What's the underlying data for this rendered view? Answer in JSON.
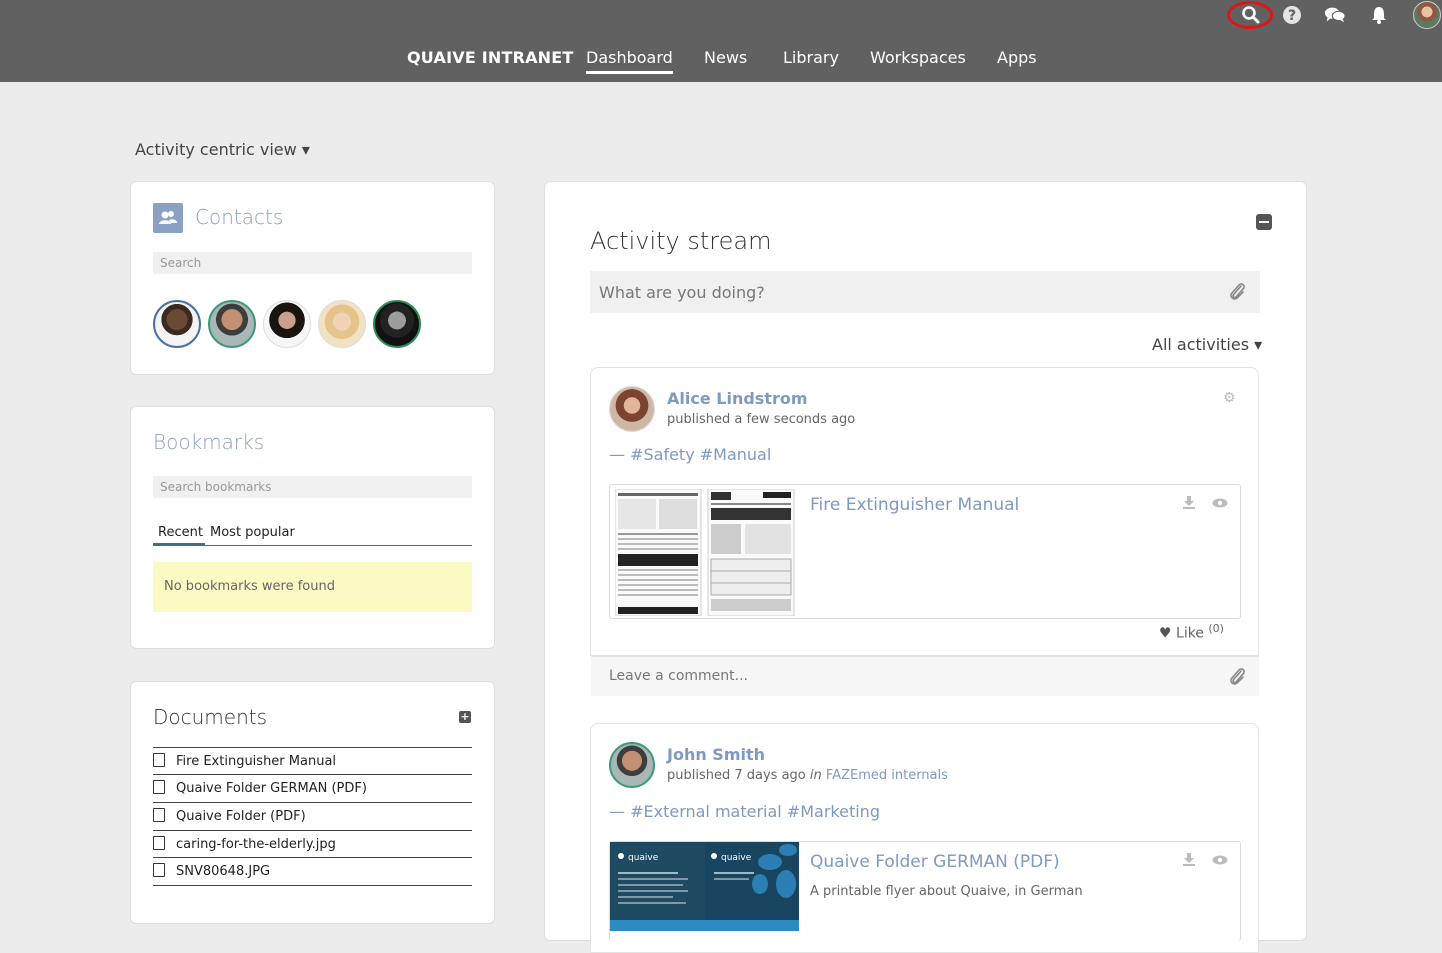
{
  "topbar": {
    "brand": "QUAIVE INTRANET",
    "nav": [
      "Dashboard",
      "News",
      "Library",
      "Workspaces",
      "Apps"
    ],
    "active_tab": "Dashboard",
    "icons": [
      "search-icon",
      "help-icon",
      "chat-icon",
      "bell-icon",
      "user-avatar"
    ],
    "colors": {
      "background": "#616161",
      "highlight_ring": "#e0151a"
    }
  },
  "view_toggle": "Activity centric view ▾",
  "contacts": {
    "title": "Contacts",
    "search_placeholder": "Search"
  },
  "bookmarks": {
    "title": "Bookmarks",
    "search_placeholder": "Search bookmarks",
    "tabs": [
      "Recent",
      "Most popular"
    ],
    "empty_message": "No bookmarks were found"
  },
  "documents": {
    "title": "Documents",
    "items": [
      "Fire Extinguisher Manual",
      "Quaive Folder GERMAN (PDF)",
      "Quaive Folder (PDF)",
      "caring-for-the-elderly.jpg",
      "SNV80648.JPG"
    ]
  },
  "activity": {
    "title": "Activity stream",
    "status_placeholder": "What are you doing?",
    "filter": "All activities",
    "posts": [
      {
        "author": "Alice Lindstrom",
        "meta": "published a few seconds ago",
        "tags": "— #Safety #Manual",
        "file_title": "Fire Extinguisher Manual",
        "like_label": "Like",
        "like_count": "(0)",
        "comment_placeholder": "Leave a comment..."
      },
      {
        "author": "John Smith",
        "meta_prefix": "published 7 days ago",
        "meta_in": "in",
        "meta_workspace": "FAZEmed internals",
        "tags": "— #External material #Marketing",
        "file_title": "Quaive Folder GERMAN (PDF)",
        "file_description": "A printable flyer about Quaive, in German",
        "thumb_brand": "quaive"
      }
    ]
  }
}
